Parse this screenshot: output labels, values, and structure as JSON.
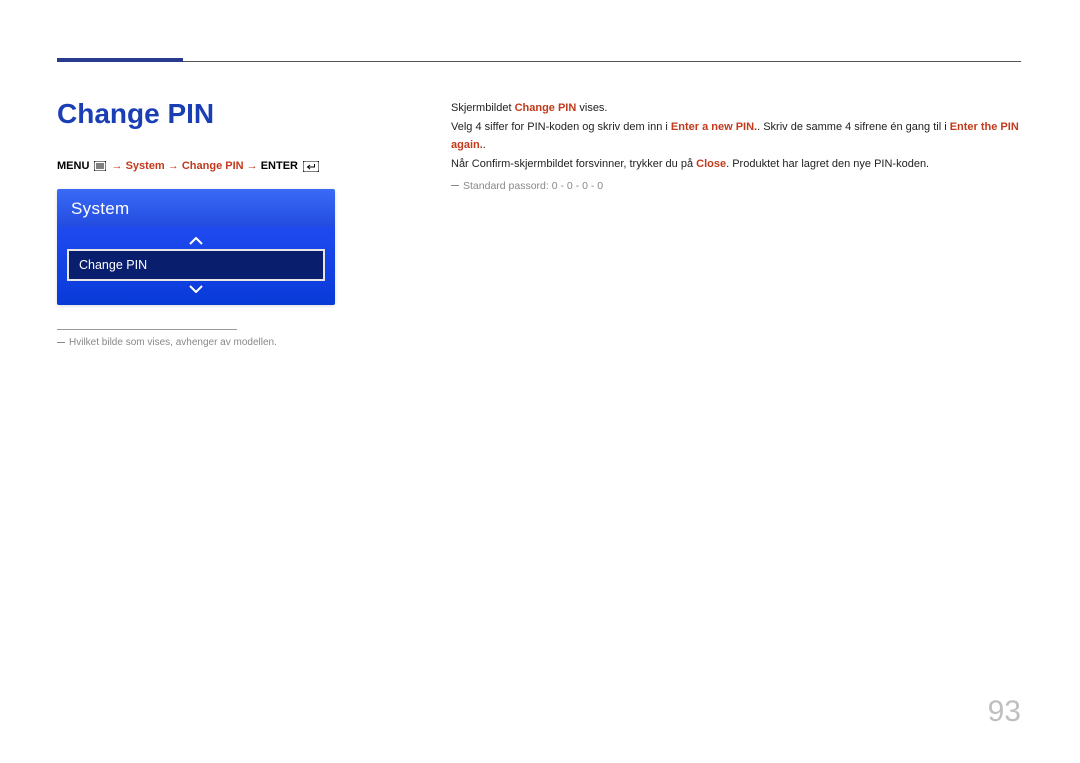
{
  "page": {
    "title": "Change PIN",
    "page_number": "93"
  },
  "breadcrumb": {
    "menu_label": "MENU",
    "system_label": "System",
    "change_pin_label": "Change PIN",
    "enter_label": "ENTER",
    "arrow": "→"
  },
  "osd": {
    "header": "System",
    "selected_item": "Change PIN"
  },
  "left_footnote": "Hvilket bilde som vises, avhenger av modellen.",
  "body": {
    "line1_a": "Skjermbildet ",
    "line1_b": "Change PIN",
    "line1_c": " vises.",
    "line2_a": "Velg 4 siffer for PIN-koden og skriv dem inn i ",
    "line2_b": "Enter a new PIN.",
    "line2_c": ". Skriv de samme 4 sifrene én gang til i ",
    "line2_d": "Enter the PIN again.",
    "line2_e": ".",
    "line3_a": "Når Confirm-skjermbildet forsvinner, trykker du på ",
    "line3_b": "Close",
    "line3_c": ". Produktet har lagret den nye PIN-koden.",
    "note": "Standard passord: 0 - 0 - 0 - 0"
  },
  "icons": {
    "menu": "menu-icon",
    "enter": "enter-icon",
    "chevron_up": "chevron-up-icon",
    "chevron_down": "chevron-down-icon"
  }
}
